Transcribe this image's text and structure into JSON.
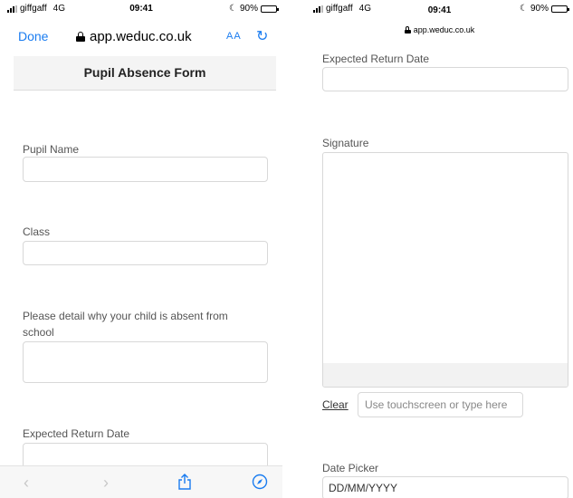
{
  "status_bar": {
    "carrier": "giffgaff",
    "network": "4G",
    "time": "09:41",
    "battery": "90%",
    "battery_level": 0.9
  },
  "browser": {
    "done_label": "Done",
    "url": "app.weduc.co.uk",
    "text_size_label": "AA",
    "reload_icon": "reload-icon",
    "toolbar_icons": [
      "back-icon",
      "forward-icon",
      "share-icon",
      "compass-icon"
    ]
  },
  "form": {
    "title": "Pupil Absence Form",
    "pupil_name_label": "Pupil Name",
    "class_label": "Class",
    "reason_label": "Please detail why your child is absent from school",
    "expected_return_label": "Expected Return Date",
    "signature_label": "Signature",
    "clear_label": "Clear",
    "signature_placeholder": "Use touchscreen or type here",
    "date_picker_label": "Date Picker",
    "date_placeholder": "DD/MM/YYYY"
  },
  "colors": {
    "accent": "#1a7cf0",
    "header_bg": "#f4f4f4",
    "field_border": "#d8d8d8"
  }
}
